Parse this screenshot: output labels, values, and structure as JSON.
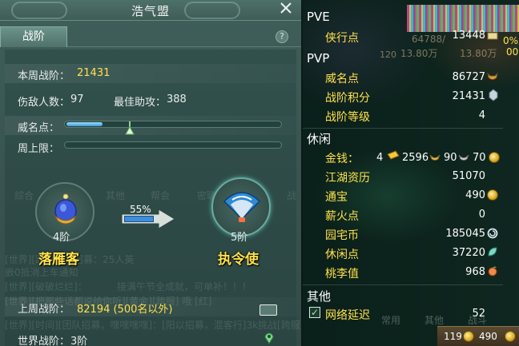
{
  "left_panel": {
    "title": "浩气盟",
    "tab_label": "战阶",
    "help_label": "?",
    "weekly_rank_label": "本周战阶：",
    "weekly_rank_value": "21431",
    "kills_label": "伤敌人数：",
    "kills_value": "97",
    "best_assist_label": "最佳助攻：",
    "best_assist_value": "388",
    "prestige_label": "威名点：",
    "prestige_fraction": 0.17,
    "weekly_cap_label": "周上限：",
    "weekly_cap_fraction": 0.0,
    "current_title": {
      "rank": "4阶",
      "name": "落雁客"
    },
    "next_title": {
      "rank": "5阶",
      "name": "执令使"
    },
    "progress_percent": "55%",
    "progress_fraction": 0.55,
    "last_week_label": "上周战阶：",
    "last_week_value": "82194 (500名以外)",
    "world_rank_label": "世界战阶：",
    "world_rank_value": "3阶",
    "background_chat": [
      "综合",
      "其他",
      "帮会",
      "密聊",
      "世界",
      "战",
      "[世界][跨服房间招募：25人英",
      "嵌0抵消上车通知",
      "[世界][破破烂烂]：",
      "接满午节全成就，可单补！！！",
      "[世界][把那些话都说给你听][黄金][跨服] 哦 [红]",
      "[世界][时间][团队招募，嘿嘿嘿嘿]：[阳以招募，混客行]3k挑战[跨服]"
    ]
  },
  "right_panel": {
    "sections": [
      {
        "header": "PVE",
        "items": [
          {
            "label": "侠行点",
            "value": "13448",
            "icon": "scroll-icon"
          }
        ]
      },
      {
        "header": "PVP",
        "items": [
          {
            "label": "威名点",
            "value": "86727",
            "icon": "ox-head-icon"
          },
          {
            "label": "战阶积分",
            "value": "21431",
            "icon": "wing-badge-icon"
          },
          {
            "label": "战阶等级",
            "value": "4",
            "icon": ""
          }
        ]
      },
      {
        "header": "休闲",
        "items": [
          {
            "label": "金钱：",
            "value": "4",
            "icon": "gold-brick-icon"
          },
          {
            "label": "江湖资历",
            "value": "51070",
            "icon": ""
          },
          {
            "label": "通宝",
            "value": "490",
            "icon": "coin-icon"
          },
          {
            "label": "薪火点",
            "value": "0",
            "icon": ""
          },
          {
            "label": "园宅币",
            "value": "185045",
            "icon": "spiral-coin-icon"
          },
          {
            "label": "休闲点",
            "value": "37220",
            "icon": "leaf-icon"
          },
          {
            "label": "桃李值",
            "value": "968",
            "icon": "peach-icon"
          }
        ]
      },
      {
        "header": "其他",
        "items": [
          {
            "label": "网络延迟",
            "value": "52",
            "icon": ""
          }
        ]
      }
    ],
    "money": {
      "gold": "4",
      "silver": "2596",
      "copper_a": "90",
      "copper_b": "70"
    },
    "background_stats": [
      "64788/",
      "13.80万",
      "13.80万",
      "120"
    ],
    "background_tabs": [
      "常用",
      "其他",
      "战斗"
    ],
    "bottom_bar": {
      "left_value": "119",
      "right_value": "490"
    },
    "percent_edge": "0%",
    "percent_edge_2": "00"
  }
}
